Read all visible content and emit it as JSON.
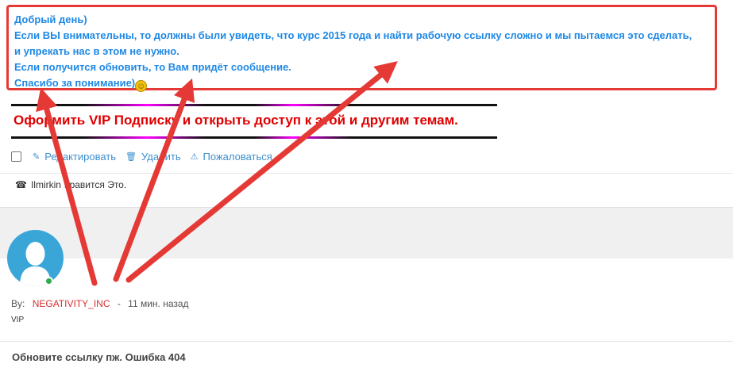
{
  "notice": {
    "line1": "Добрый день)",
    "line2": "Если ВЫ внимательны, то должны были увидеть, что курс 2015 года и найти рабочую ссылку сложно и мы пытаемся это сделать,",
    "line3": "и упрекать нас в этом не нужно.",
    "line4": "Если получится обновить, то Вам придёт сообщение.",
    "line5": "Спасибо за понимание)",
    "border_color": "#e53935",
    "text_color": "#1e88e5"
  },
  "vip_banner": {
    "text": "Оформить VIP Подписку и открыть доступ к этой и другим темам.",
    "text_color": "#e00000"
  },
  "actions": {
    "edit": "Редактировать",
    "delete": "Удалить",
    "report": "Пожаловаться"
  },
  "likes": {
    "user": "Ilmirkin",
    "text": "нравится Это."
  },
  "post": {
    "by_label": "By:",
    "author": "NEGATIVITY_INC",
    "time": "11 мин. назад",
    "rank": "VIP",
    "body": "Обновите ссылку пж. Ошибка 404"
  },
  "annotation_color": "#e53935"
}
